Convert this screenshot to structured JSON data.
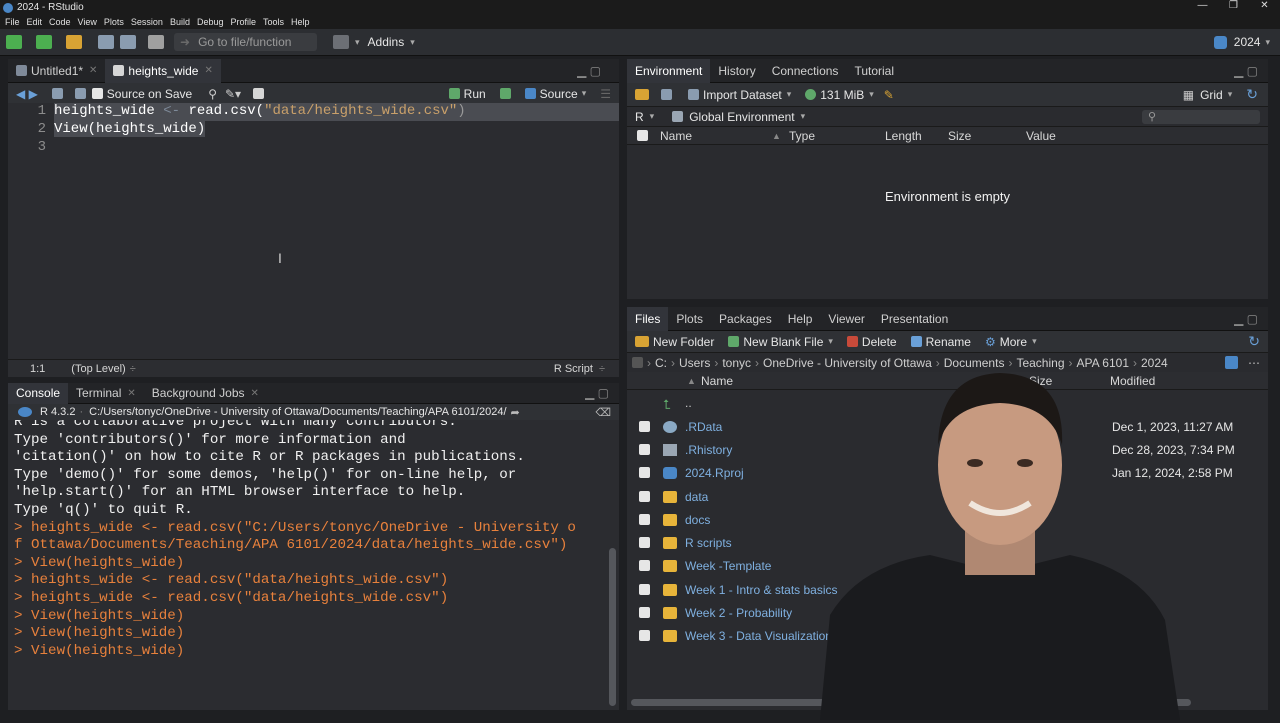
{
  "window": {
    "title": "2024 - RStudio",
    "controls": [
      "—",
      "❐",
      "✕"
    ]
  },
  "menu": [
    "File",
    "Edit",
    "Code",
    "View",
    "Plots",
    "Session",
    "Build",
    "Debug",
    "Profile",
    "Tools",
    "Help"
  ],
  "toolbar": {
    "goto_placeholder": "Go to file/function",
    "addins": "Addins",
    "project": "2024"
  },
  "source": {
    "tabs": [
      "Untitled1*",
      "heights_wide"
    ],
    "toolbar": {
      "source_on_save": "Source on Save",
      "run": "Run",
      "source": "Source"
    },
    "line_numbers": [
      "1",
      "2",
      "3"
    ],
    "code": [
      {
        "var": "heights_wide",
        "op": " <- ",
        "fn": "read.csv(",
        "str": "\"data/heights_wide.csv\"",
        "end": ")"
      },
      {
        "text": "View(heights_wide)"
      }
    ],
    "status": {
      "position": "1:1",
      "scope": "(Top Level)",
      "type": "R Script"
    }
  },
  "console": {
    "tabs": [
      "Console",
      "Terminal",
      "Background Jobs"
    ],
    "r_version": "R 4.3.2",
    "path": "C:/Users/tonyc/OneDrive - University of Ottawa/Documents/Teaching/APA 6101/2024/",
    "output": [
      {
        "t": "R is a collaborative project with many contributors.",
        "c": ""
      },
      {
        "t": "Type 'contributors()' for more information and",
        "c": ""
      },
      {
        "t": "'citation()' on how to cite R or R packages in publications.",
        "c": ""
      },
      {
        "t": " ",
        "c": ""
      },
      {
        "t": "Type 'demo()' for some demos, 'help()' for on-line help, or",
        "c": ""
      },
      {
        "t": "'help.start()' for an HTML browser interface to help.",
        "c": ""
      },
      {
        "t": "Type 'q()' to quit R.",
        "c": ""
      },
      {
        "t": " ",
        "c": ""
      },
      {
        "t": "> heights_wide <- read.csv(\"C:/Users/tonyc/OneDrive - University o",
        "c": "cmd"
      },
      {
        "t": "f Ottawa/Documents/Teaching/APA 6101/2024/data/heights_wide.csv\")",
        "c": "cmd"
      },
      {
        "t": ">   View(heights_wide)",
        "c": "cmd"
      },
      {
        "t": "> heights_wide <- read.csv(\"data/heights_wide.csv\")",
        "c": "cmd"
      },
      {
        "t": "> heights_wide <- read.csv(\"data/heights_wide.csv\")",
        "c": "cmd"
      },
      {
        "t": "> View(heights_wide)",
        "c": "cmd"
      },
      {
        "t": "> View(heights_wide)",
        "c": "cmd"
      },
      {
        "t": "> View(heights_wide)",
        "c": "cmd"
      }
    ]
  },
  "environment": {
    "tabs": [
      "Environment",
      "History",
      "Connections",
      "Tutorial"
    ],
    "toolbar": {
      "import": "Import Dataset",
      "memory": "131 MiB",
      "view": "Grid"
    },
    "lang": "R",
    "scope": "Global Environment",
    "columns": [
      "Name",
      "Type",
      "Length",
      "Size",
      "Value"
    ],
    "empty_msg": "Environment is empty"
  },
  "files": {
    "tabs": [
      "Files",
      "Plots",
      "Packages",
      "Help",
      "Viewer",
      "Presentation"
    ],
    "toolbar": {
      "new_folder": "New Folder",
      "new_file": "New Blank File",
      "delete": "Delete",
      "rename": "Rename",
      "more": "More"
    },
    "breadcrumb": [
      "C:",
      "Users",
      "tonyc",
      "OneDrive - University of Ottawa",
      "Documents",
      "Teaching",
      "APA 6101",
      "2024"
    ],
    "columns": {
      "name": "Name",
      "size": "Size",
      "modified": "Modified"
    },
    "up": "..",
    "rows": [
      {
        "name": ".RData",
        "size": "B",
        "modified": "Dec 1, 2023, 11:27 AM",
        "kind": "rdata"
      },
      {
        "name": ".Rhistory",
        "size": "B",
        "modified": "Dec 28, 2023, 7:34 PM",
        "kind": "rhistory"
      },
      {
        "name": "2024.Rproj",
        "size": "",
        "modified": "Jan 12, 2024, 2:58 PM",
        "kind": "rproj"
      },
      {
        "name": "data",
        "size": "",
        "modified": "",
        "kind": "folder"
      },
      {
        "name": "docs",
        "size": "",
        "modified": "",
        "kind": "folder"
      },
      {
        "name": "R scripts",
        "size": "",
        "modified": "",
        "kind": "folder"
      },
      {
        "name": "Week -Template",
        "size": "",
        "modified": "",
        "kind": "folder"
      },
      {
        "name": "Week 1 - Intro & stats basics",
        "size": "",
        "modified": "",
        "kind": "folder"
      },
      {
        "name": "Week 2 - Probability",
        "size": "",
        "modified": "",
        "kind": "folder"
      },
      {
        "name": "Week 3 - Data Visualization",
        "size": "",
        "modified": "",
        "kind": "folder"
      }
    ]
  },
  "colors": {
    "accent": "#4a87c7",
    "console_cmd": "#e8813c",
    "folder": "#e7b43a",
    "string": "#c9a06a"
  }
}
